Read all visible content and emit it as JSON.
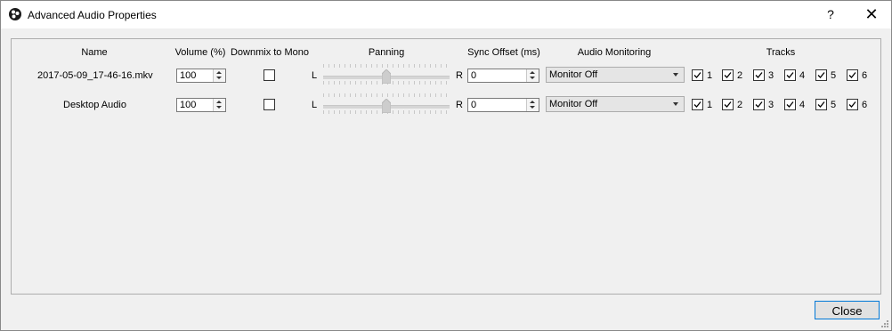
{
  "window": {
    "title": "Advanced Audio Properties",
    "help_label": "?",
    "close_label": "✕"
  },
  "headers": {
    "name": "Name",
    "volume": "Volume (%)",
    "downmix": "Downmix to Mono",
    "panning": "Panning",
    "sync": "Sync Offset (ms)",
    "monitoring": "Audio Monitoring",
    "tracks": "Tracks"
  },
  "pan_left": "L",
  "pan_right": "R",
  "rows": [
    {
      "name": "2017-05-09_17-46-16.mkv",
      "volume": "100",
      "downmix_checked": false,
      "pan": 0.5,
      "sync": "0",
      "monitoring": "Monitor Off",
      "tracks": [
        {
          "label": "1",
          "checked": true
        },
        {
          "label": "2",
          "checked": true
        },
        {
          "label": "3",
          "checked": true
        },
        {
          "label": "4",
          "checked": true
        },
        {
          "label": "5",
          "checked": true
        },
        {
          "label": "6",
          "checked": true
        }
      ]
    },
    {
      "name": "Desktop Audio",
      "volume": "100",
      "downmix_checked": false,
      "pan": 0.5,
      "sync": "0",
      "monitoring": "Monitor Off",
      "tracks": [
        {
          "label": "1",
          "checked": true
        },
        {
          "label": "2",
          "checked": true
        },
        {
          "label": "3",
          "checked": true
        },
        {
          "label": "4",
          "checked": true
        },
        {
          "label": "5",
          "checked": true
        },
        {
          "label": "6",
          "checked": true
        }
      ]
    }
  ],
  "footer": {
    "close_button": "Close"
  },
  "icons": {
    "app": "obs-logo-icon",
    "help": "help-icon",
    "close": "close-icon",
    "resize": "resize-grip-icon"
  }
}
